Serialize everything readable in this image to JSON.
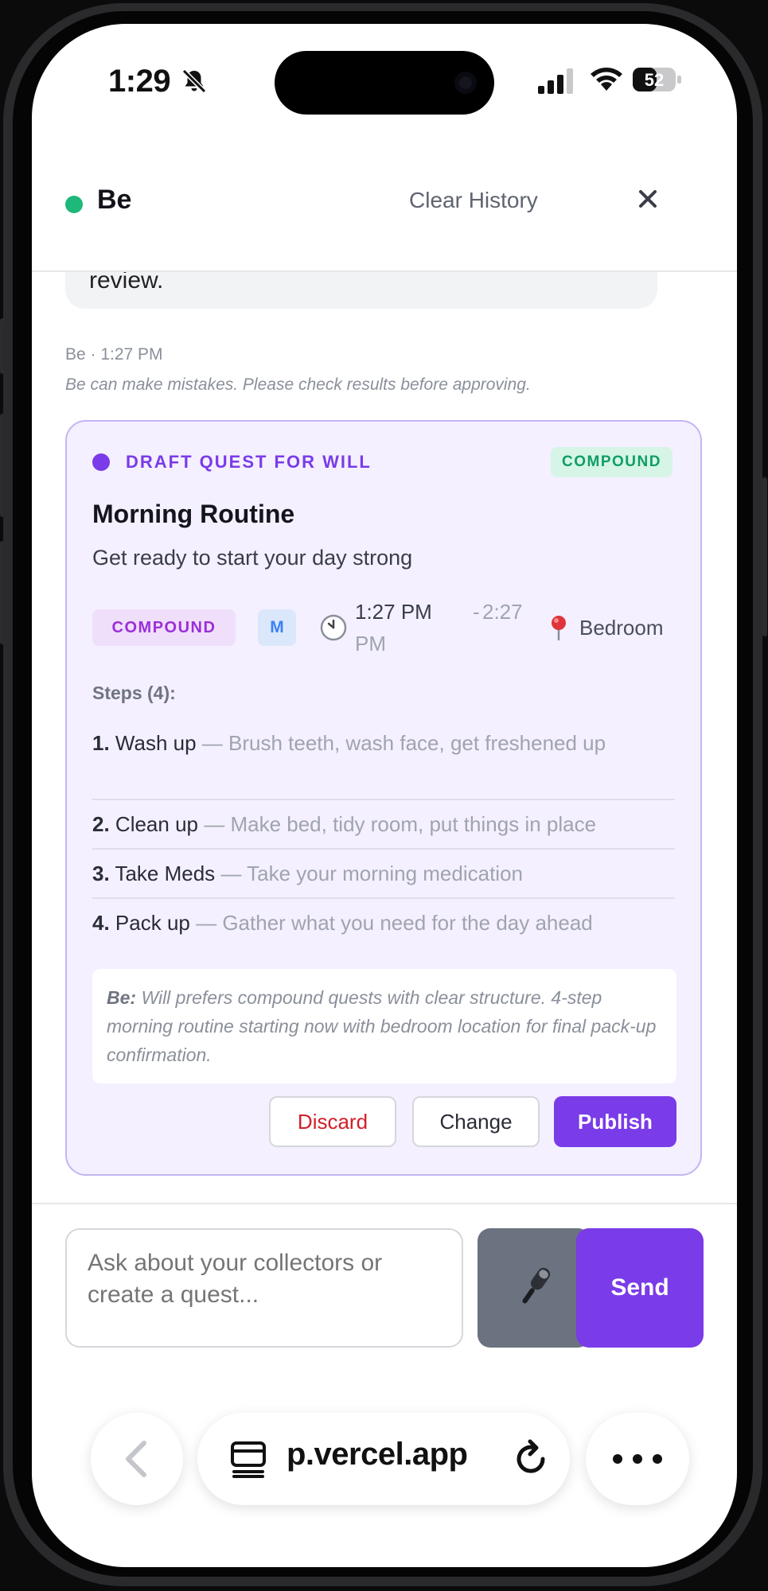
{
  "status_bar": {
    "time": "1:29",
    "battery": "52"
  },
  "chat": {
    "assistant_name": "Be",
    "clear_history_label": "Clear History",
    "previous_message_tail": "review.",
    "message_meta": "Be · 1:27 PM",
    "disclaimer": "Be can make mistakes. Please check results before approving."
  },
  "draft_card": {
    "label": "DRAFT QUEST FOR WILL",
    "type_badge": "COMPOUND",
    "title": "Morning Routine",
    "subtitle": "Get ready to start your day strong",
    "tag_type": "COMPOUND",
    "tag_size": "M",
    "time_start": "1:27 PM",
    "time_separator": "-",
    "time_end_part1": "2:27",
    "time_end_part2": "PM",
    "location": "Bedroom",
    "steps_heading": "Steps (4):",
    "steps": [
      {
        "num": "1.",
        "name": "Wash up",
        "desc": " — Brush teeth, wash face, get freshened up"
      },
      {
        "num": "2.",
        "name": "Clean up",
        "desc": " — Make bed, tidy room, put things in place"
      },
      {
        "num": "3.",
        "name": "Take Meds",
        "desc": " — Take your morning medication"
      },
      {
        "num": "4.",
        "name": "Pack up",
        "desc": " — Gather what you need for the day ahead"
      }
    ],
    "note_author": "Be:",
    "note_text": " Will prefers compound quests with clear structure. 4-step morning routine starting now with bedroom location for final pack-up confirmation.",
    "discard_label": "Discard",
    "change_label": "Change",
    "publish_label": "Publish"
  },
  "composer": {
    "placeholder": "Ask about your collectors or create a quest...",
    "send_label": "Send"
  },
  "browser": {
    "url": "p.vercel.app"
  },
  "colors": {
    "accent": "#7a3be8",
    "online": "#1db87a",
    "discard": "#d1202a",
    "compound_green": "#0f9e63"
  },
  "icons": [
    "bell-slash-icon",
    "signal-icon",
    "wifi-icon",
    "battery-icon",
    "close-icon",
    "clock-icon",
    "pin-icon",
    "microphone-icon",
    "back-icon",
    "tabs-icon",
    "reload-icon",
    "more-icon"
  ]
}
